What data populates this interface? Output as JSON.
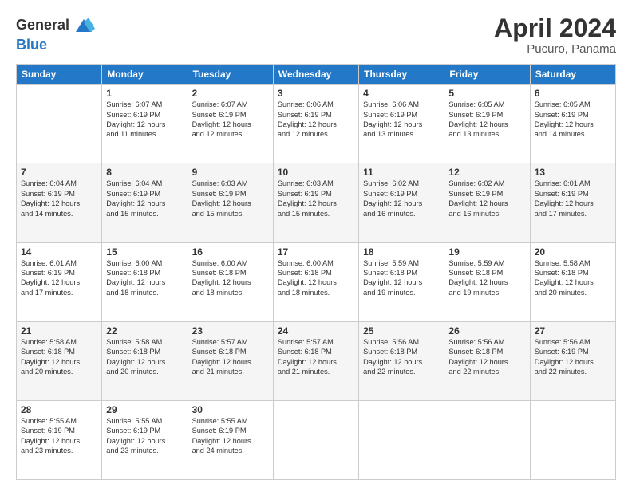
{
  "header": {
    "logo_general": "General",
    "logo_blue": "Blue",
    "month": "April 2024",
    "location": "Pucuro, Panama"
  },
  "days": [
    "Sunday",
    "Monday",
    "Tuesday",
    "Wednesday",
    "Thursday",
    "Friday",
    "Saturday"
  ],
  "weeks": [
    [
      {
        "day": "",
        "info": ""
      },
      {
        "day": "1",
        "info": "Sunrise: 6:07 AM\nSunset: 6:19 PM\nDaylight: 12 hours\nand 11 minutes."
      },
      {
        "day": "2",
        "info": "Sunrise: 6:07 AM\nSunset: 6:19 PM\nDaylight: 12 hours\nand 12 minutes."
      },
      {
        "day": "3",
        "info": "Sunrise: 6:06 AM\nSunset: 6:19 PM\nDaylight: 12 hours\nand 12 minutes."
      },
      {
        "day": "4",
        "info": "Sunrise: 6:06 AM\nSunset: 6:19 PM\nDaylight: 12 hours\nand 13 minutes."
      },
      {
        "day": "5",
        "info": "Sunrise: 6:05 AM\nSunset: 6:19 PM\nDaylight: 12 hours\nand 13 minutes."
      },
      {
        "day": "6",
        "info": "Sunrise: 6:05 AM\nSunset: 6:19 PM\nDaylight: 12 hours\nand 14 minutes."
      }
    ],
    [
      {
        "day": "7",
        "info": "Sunrise: 6:04 AM\nSunset: 6:19 PM\nDaylight: 12 hours\nand 14 minutes."
      },
      {
        "day": "8",
        "info": "Sunrise: 6:04 AM\nSunset: 6:19 PM\nDaylight: 12 hours\nand 15 minutes."
      },
      {
        "day": "9",
        "info": "Sunrise: 6:03 AM\nSunset: 6:19 PM\nDaylight: 12 hours\nand 15 minutes."
      },
      {
        "day": "10",
        "info": "Sunrise: 6:03 AM\nSunset: 6:19 PM\nDaylight: 12 hours\nand 15 minutes."
      },
      {
        "day": "11",
        "info": "Sunrise: 6:02 AM\nSunset: 6:19 PM\nDaylight: 12 hours\nand 16 minutes."
      },
      {
        "day": "12",
        "info": "Sunrise: 6:02 AM\nSunset: 6:19 PM\nDaylight: 12 hours\nand 16 minutes."
      },
      {
        "day": "13",
        "info": "Sunrise: 6:01 AM\nSunset: 6:19 PM\nDaylight: 12 hours\nand 17 minutes."
      }
    ],
    [
      {
        "day": "14",
        "info": "Sunrise: 6:01 AM\nSunset: 6:19 PM\nDaylight: 12 hours\nand 17 minutes."
      },
      {
        "day": "15",
        "info": "Sunrise: 6:00 AM\nSunset: 6:18 PM\nDaylight: 12 hours\nand 18 minutes."
      },
      {
        "day": "16",
        "info": "Sunrise: 6:00 AM\nSunset: 6:18 PM\nDaylight: 12 hours\nand 18 minutes."
      },
      {
        "day": "17",
        "info": "Sunrise: 6:00 AM\nSunset: 6:18 PM\nDaylight: 12 hours\nand 18 minutes."
      },
      {
        "day": "18",
        "info": "Sunrise: 5:59 AM\nSunset: 6:18 PM\nDaylight: 12 hours\nand 19 minutes."
      },
      {
        "day": "19",
        "info": "Sunrise: 5:59 AM\nSunset: 6:18 PM\nDaylight: 12 hours\nand 19 minutes."
      },
      {
        "day": "20",
        "info": "Sunrise: 5:58 AM\nSunset: 6:18 PM\nDaylight: 12 hours\nand 20 minutes."
      }
    ],
    [
      {
        "day": "21",
        "info": "Sunrise: 5:58 AM\nSunset: 6:18 PM\nDaylight: 12 hours\nand 20 minutes."
      },
      {
        "day": "22",
        "info": "Sunrise: 5:58 AM\nSunset: 6:18 PM\nDaylight: 12 hours\nand 20 minutes."
      },
      {
        "day": "23",
        "info": "Sunrise: 5:57 AM\nSunset: 6:18 PM\nDaylight: 12 hours\nand 21 minutes."
      },
      {
        "day": "24",
        "info": "Sunrise: 5:57 AM\nSunset: 6:18 PM\nDaylight: 12 hours\nand 21 minutes."
      },
      {
        "day": "25",
        "info": "Sunrise: 5:56 AM\nSunset: 6:18 PM\nDaylight: 12 hours\nand 22 minutes."
      },
      {
        "day": "26",
        "info": "Sunrise: 5:56 AM\nSunset: 6:18 PM\nDaylight: 12 hours\nand 22 minutes."
      },
      {
        "day": "27",
        "info": "Sunrise: 5:56 AM\nSunset: 6:19 PM\nDaylight: 12 hours\nand 22 minutes."
      }
    ],
    [
      {
        "day": "28",
        "info": "Sunrise: 5:55 AM\nSunset: 6:19 PM\nDaylight: 12 hours\nand 23 minutes."
      },
      {
        "day": "29",
        "info": "Sunrise: 5:55 AM\nSunset: 6:19 PM\nDaylight: 12 hours\nand 23 minutes."
      },
      {
        "day": "30",
        "info": "Sunrise: 5:55 AM\nSunset: 6:19 PM\nDaylight: 12 hours\nand 24 minutes."
      },
      {
        "day": "",
        "info": ""
      },
      {
        "day": "",
        "info": ""
      },
      {
        "day": "",
        "info": ""
      },
      {
        "day": "",
        "info": ""
      }
    ]
  ]
}
